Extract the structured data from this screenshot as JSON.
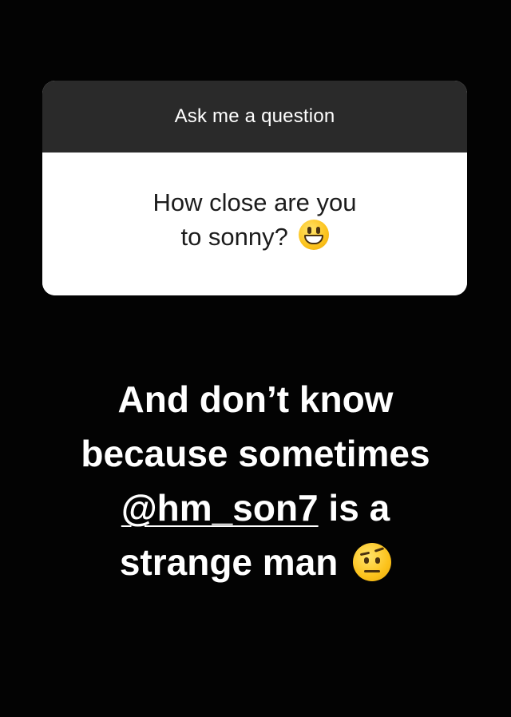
{
  "question_sticker": {
    "header": "Ask me a question",
    "question_line1": "How close are you",
    "question_line2": "to sonny?",
    "question_emoji": "grinning-face-icon"
  },
  "caption": {
    "line1": "And don’t know",
    "line2": "because sometimes",
    "mention": "@hm_son7",
    "line3_rest": "is a",
    "line4": "strange man",
    "line4_emoji": "raised-eyebrow-face-icon"
  },
  "colors": {
    "background": "#030303",
    "sticker_header": "#2a2a2a",
    "sticker_body": "#ffffff",
    "caption_text": "#ffffff"
  }
}
